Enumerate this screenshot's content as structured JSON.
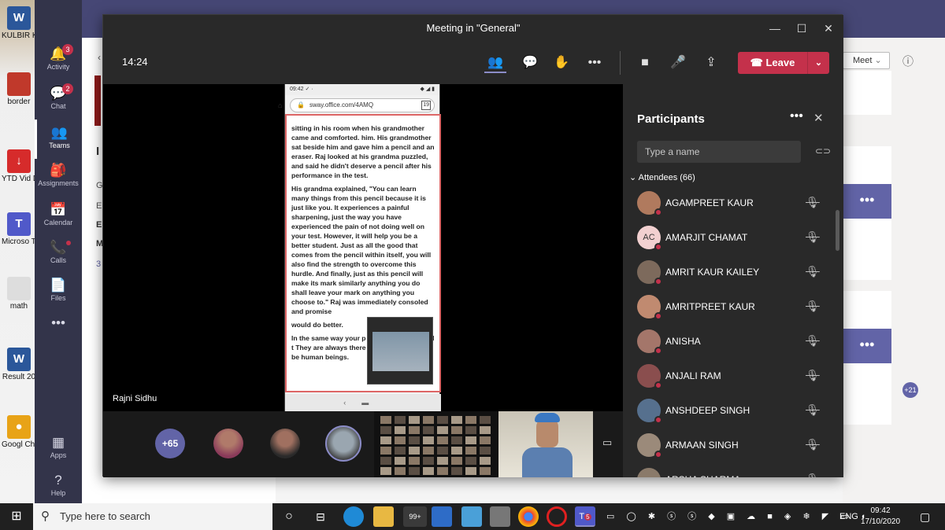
{
  "desktop_icons": [
    {
      "label": "KULBIR K RESUM",
      "icon": "word-doc-icon",
      "color": "#2b579a",
      "glyph": "W"
    },
    {
      "label": "border",
      "icon": "image-file-icon",
      "color": "#c0392b",
      "glyph": ""
    },
    {
      "label": "YTD Vid Downlo",
      "icon": "download-app-icon",
      "color": "#d62b2b",
      "glyph": "↓"
    },
    {
      "label": "Microso Team",
      "icon": "teams-app-icon",
      "color": "#5059c9",
      "glyph": "T"
    },
    {
      "label": "math",
      "icon": "spreadsheet-icon",
      "color": "#ddd",
      "glyph": ""
    },
    {
      "label": "Result 20",
      "icon": "word-doc-icon",
      "color": "#2b579a",
      "glyph": "W"
    },
    {
      "label": "Googl Chrom",
      "icon": "chrome-icon",
      "color": "#e8a317",
      "glyph": "●"
    }
  ],
  "teams_rail": [
    {
      "label": "Activity",
      "icon": "bell-icon",
      "glyph": "🔔",
      "badge": "3"
    },
    {
      "label": "Chat",
      "icon": "chat-icon",
      "glyph": "💬",
      "badge": "2"
    },
    {
      "label": "Teams",
      "icon": "teams-icon",
      "glyph": "👥",
      "badge": ""
    },
    {
      "label": "Assignments",
      "icon": "assignments-icon",
      "glyph": "🎒",
      "badge": ""
    },
    {
      "label": "Calendar",
      "icon": "calendar-icon",
      "glyph": "📅",
      "badge": ""
    },
    {
      "label": "Calls",
      "icon": "phone-icon",
      "glyph": "📞",
      "badge": ""
    },
    {
      "label": "Files",
      "icon": "file-icon",
      "glyph": "📄",
      "badge": ""
    },
    {
      "label": "",
      "icon": "more-icon",
      "glyph": "•••",
      "badge": ""
    }
  ],
  "teams_rail_bottom": [
    {
      "label": "Apps",
      "icon": "apps-icon",
      "glyph": "▦"
    },
    {
      "label": "Help",
      "icon": "help-icon",
      "glyph": "?"
    }
  ],
  "background_fragments": {
    "meet_label": "Meet",
    "left_letters": [
      "I",
      "G",
      "E",
      "E",
      "M",
      "3"
    ],
    "plus_count": "+21"
  },
  "meeting": {
    "window_title": "Meeting in \"General\"",
    "elapsed_time": "14:24",
    "leave_label": "Leave",
    "speaker_name": "Rajni Sidhu",
    "overflow_count": "+65"
  },
  "shared_phone": {
    "status_time": "09:42",
    "url": "sway.office.com/4AMQ",
    "tab_count": "19",
    "paragraphs": [
      "sitting in his room when his grandmother came and comforted. him. His grandmother sat beside him and gave him a pencil and an eraser. Raj looked at his grandma puzzled, and said he didn't deserve a pencil after his performance in the test.",
      "His grandma explained, \"You can learn many things from this pencil because it is just like you. It experiences a painful sharpening, just the way you have experienced the pain of not doing well on your test. However, it will help you be a better student. Just as all the good that comes from the pencil within itself, you will also find the strength to overcome this hurdle. And finally, just as this pencil will make its mark similarly anything you do shall leave your mark on anything you choose to.\" Raj was immediately consoled and promise",
      "would do better.",
      "In the same way your p eraser which is used t They are always there help the children to be human beings."
    ]
  },
  "participants": {
    "title": "Participants",
    "search_placeholder": "Type a name",
    "attendees_label": "Attendees (66)",
    "list": [
      {
        "name": "AGAMPREET KAUR",
        "initials": "",
        "avatar_color": "#b07a5e"
      },
      {
        "name": "AMARJIT CHAMAT",
        "initials": "AC",
        "avatar_color": "#f2d0d0"
      },
      {
        "name": "AMRIT KAUR KAILEY",
        "initials": "",
        "avatar_color": "#7d6a5c"
      },
      {
        "name": "AMRITPREET KAUR",
        "initials": "",
        "avatar_color": "#c08a70"
      },
      {
        "name": "ANISHA",
        "initials": "",
        "avatar_color": "#a4766a"
      },
      {
        "name": "ANJALI RAM",
        "initials": "",
        "avatar_color": "#8a4e4e"
      },
      {
        "name": "ANSHDEEP SINGH",
        "initials": "",
        "avatar_color": "#56708e"
      },
      {
        "name": "ARMAAN SINGH",
        "initials": "",
        "avatar_color": "#9b8a7a"
      },
      {
        "name": "ARSHA SHARMA",
        "initials": "",
        "avatar_color": "#8a7a6a"
      }
    ]
  },
  "taskbar": {
    "search_placeholder": "Type here to search",
    "language": "ENG",
    "time": "09:42",
    "date": "17/10/2020",
    "teams_badge": "5",
    "edge_badge": "99+"
  }
}
